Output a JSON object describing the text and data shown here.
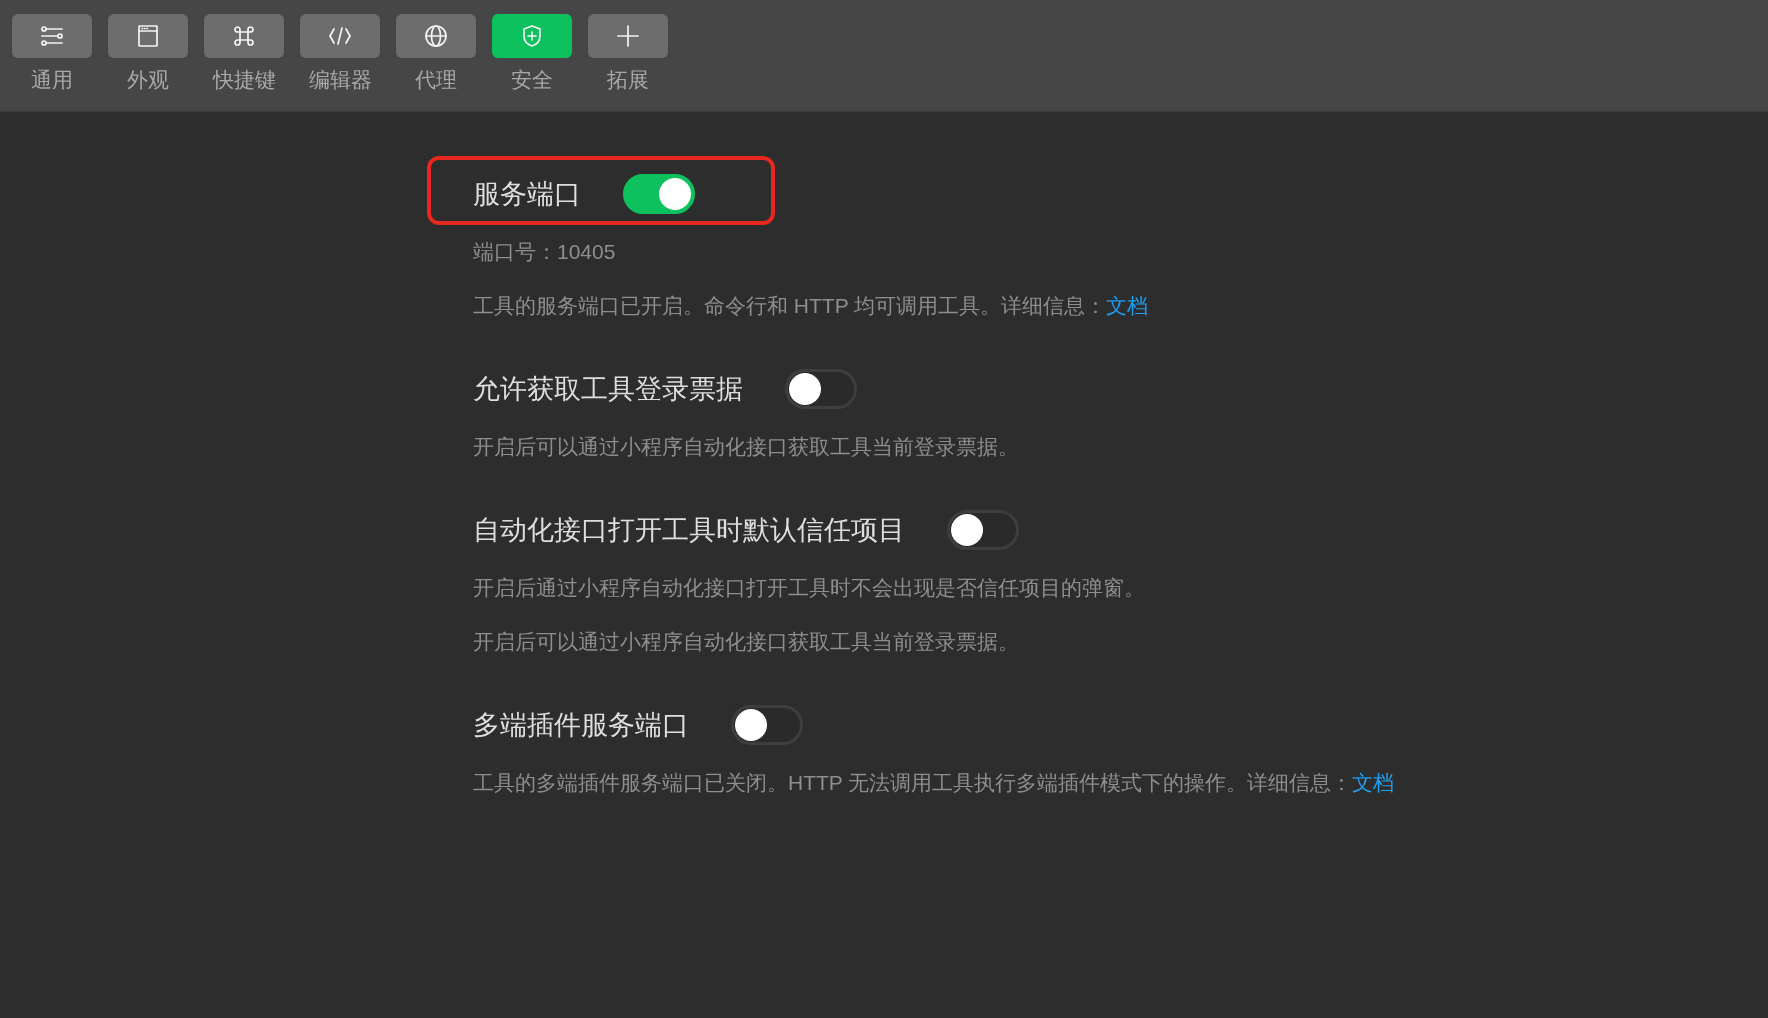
{
  "toolbar": [
    {
      "label": "通用",
      "selected": false
    },
    {
      "label": "外观",
      "selected": false
    },
    {
      "label": "快捷键",
      "selected": false
    },
    {
      "label": "编辑器",
      "selected": false
    },
    {
      "label": "代理",
      "selected": false
    },
    {
      "label": "安全",
      "selected": true
    },
    {
      "label": "拓展",
      "selected": false
    }
  ],
  "settings": [
    {
      "title": "服务端口",
      "on": true,
      "highlighted": true,
      "lines": [
        {
          "text": "端口号：10405"
        },
        {
          "text": "工具的服务端口已开启。命令行和 HTTP 均可调用工具。详细信息：",
          "link": "文档"
        }
      ]
    },
    {
      "title": "允许获取工具登录票据",
      "on": false,
      "highlighted": false,
      "lines": [
        {
          "text": "开启后可以通过小程序自动化接口获取工具当前登录票据。"
        }
      ]
    },
    {
      "title": "自动化接口打开工具时默认信任项目",
      "on": false,
      "highlighted": false,
      "lines": [
        {
          "text": "开启后通过小程序自动化接口打开工具时不会出现是否信任项目的弹窗。"
        },
        {
          "text": "开启后可以通过小程序自动化接口获取工具当前登录票据。"
        }
      ]
    },
    {
      "title": "多端插件服务端口",
      "on": false,
      "highlighted": false,
      "lines": [
        {
          "text": "工具的多端插件服务端口已关闭。HTTP 无法调用工具执行多端插件模式下的操作。详细信息：",
          "link": "文档"
        }
      ]
    }
  ]
}
